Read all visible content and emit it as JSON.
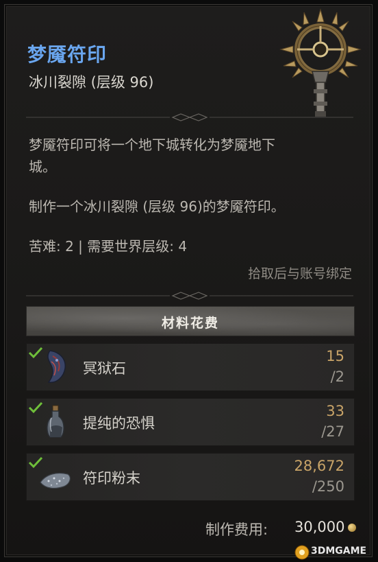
{
  "item": {
    "title": "梦魇符印",
    "subtitle": "冰川裂隙 (层级 96)",
    "icon": "nightmare-sigil-icon",
    "description_1": "梦魇符印可将一个地下城转化为梦魇地下",
    "description_2": "城。",
    "description_3": "制作一个冰川裂隙 (层级 96)的梦魇符印。",
    "stats": "苦难: 2 | 需要世界层级: 4",
    "bind_note": "拾取后与账号绑定"
  },
  "materials": {
    "header": "材料花费",
    "items": [
      {
        "name": "冥狱石",
        "have": "15",
        "need": "/2",
        "icon": "obducite-icon",
        "check": "checkmark-icon"
      },
      {
        "name": "提纯的恐惧",
        "have": "33",
        "need": "/27",
        "icon": "distilled-fear-icon",
        "check": "checkmark-icon"
      },
      {
        "name": "符印粉末",
        "have": "28,672",
        "need": "/250",
        "icon": "sigil-powder-icon",
        "check": "checkmark-icon"
      }
    ]
  },
  "cost": {
    "label": "制作费用:",
    "value": "30,000",
    "icon": "gold-coin-icon"
  },
  "watermark": {
    "text": "3DMGAME"
  },
  "colors": {
    "title": "#6aa6ef",
    "check": "#6fbf3a",
    "have_amount": "#c9a468"
  }
}
